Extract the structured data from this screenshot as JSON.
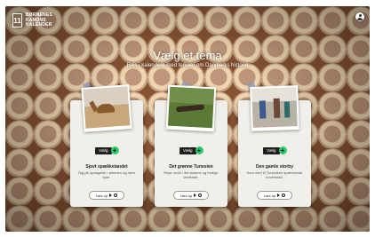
{
  "brand": {
    "line1": "BØRNENES",
    "line2": "KANONS",
    "line3": "KALENDER",
    "mark": "11"
  },
  "heading": {
    "title": "Vælg et tema",
    "subtitle": "Rejs i kalendere med temaer om Danmarks historie"
  },
  "cards": [
    {
      "button": "Vælg",
      "title": "Sjovt spækketandet",
      "desc": "Tag på opdagelse i ørkenen og dens byer.",
      "read": "Læs op"
    },
    {
      "button": "Vælg",
      "title": "Det grønne Tunesien",
      "desc": "Rejst rundt i det skønne og frodige landskab.",
      "read": "Læs op"
    },
    {
      "button": "Vælg",
      "title": "Den gamle storby",
      "desc": "Kom med til Tunesiens spændende hovedstad.",
      "read": "Læs op"
    }
  ],
  "colors": {
    "accent": "#2ecc71",
    "button_dark": "#1e1e1e",
    "card_bg": "#f1efe9"
  },
  "icons": {
    "user": "user-icon",
    "plus": "plus-icon",
    "play": "play-icon",
    "clock": "clock-icon"
  }
}
